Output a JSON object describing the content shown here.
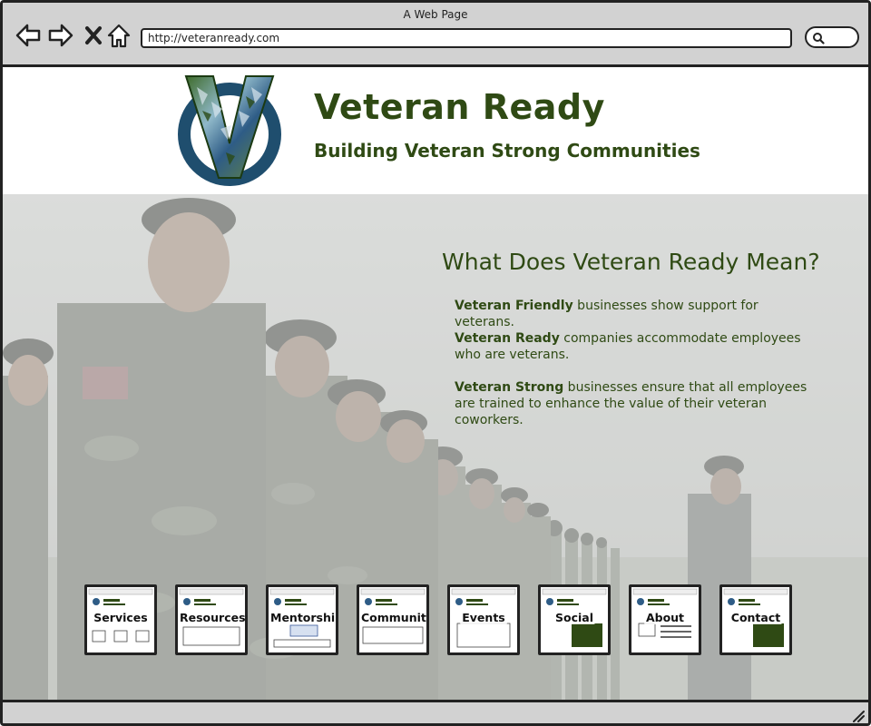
{
  "window": {
    "title": "A Web Page",
    "url": "http://veteranready.com"
  },
  "header": {
    "title": "Veteran Ready",
    "tagline": "Building Veteran Strong Communities"
  },
  "intro": {
    "heading": "What Does Veteran Ready Mean?",
    "items": [
      {
        "term": "Veteran Friendly",
        "text": " businesses show support for veterans."
      },
      {
        "term": "Veteran Ready",
        "text": " companies accommodate employees who are veterans."
      },
      {
        "term": "Veteran Strong",
        "text": " businesses ensure that all employees are trained to enhance the value of their veteran coworkers."
      }
    ]
  },
  "tiles": [
    {
      "label": "Services"
    },
    {
      "label": "Resources"
    },
    {
      "label": "Mentorship"
    },
    {
      "label": "Community"
    },
    {
      "label": "Events"
    },
    {
      "label": "Social"
    },
    {
      "label": "About"
    },
    {
      "label": "Contact"
    }
  ],
  "icons": {
    "back": "back-arrow-icon",
    "forward": "forward-arrow-icon",
    "stop": "close-icon",
    "home": "home-icon",
    "search": "search-icon",
    "resize": "resize-grip-icon"
  },
  "colors": {
    "brand_green": "#2f4a14",
    "logo_blue": "#1f4e6e"
  }
}
